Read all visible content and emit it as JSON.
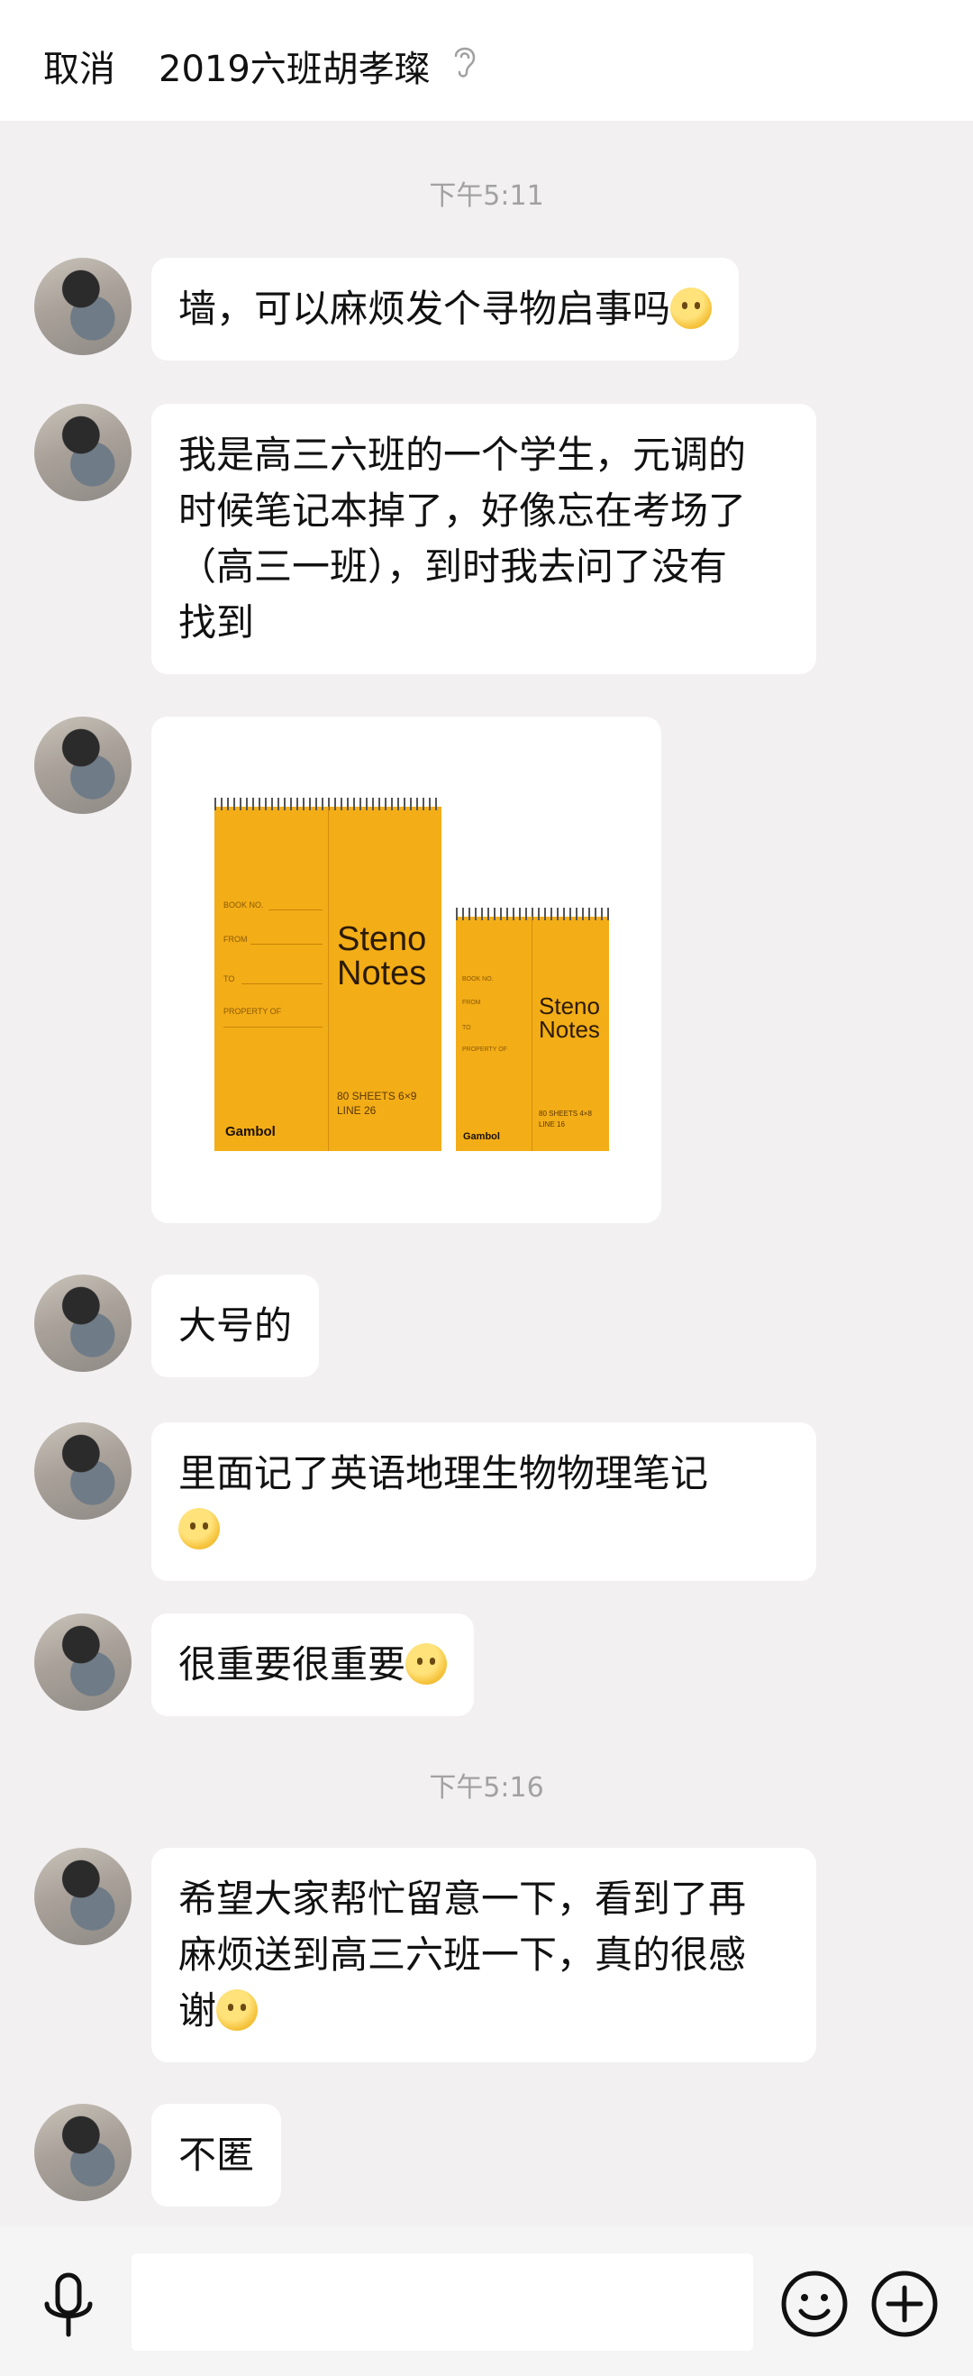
{
  "header": {
    "cancel_label": "取消",
    "title": "2019六班胡孝璨",
    "mode_icon": "ear-icon"
  },
  "timestamps": [
    "下午5:11",
    "下午5:16"
  ],
  "messages": [
    {
      "lines": [
        "墙，可以麻烦发个寻物启事吗"
      ],
      "emoji": "smile-emoji"
    },
    {
      "lines": [
        "我是高三六班的一个学生，元调的",
        "时候笔记本掉了，好像忘在考场了",
        "（高三一班），到时我去问了没有",
        "找到"
      ]
    },
    {
      "image": "steno-notebooks-photo"
    },
    {
      "lines": [
        "大号的"
      ]
    },
    {
      "lines": [
        "里面记了英语地理生物物理笔记"
      ],
      "emoji": "thinking-emoji"
    },
    {
      "lines": [
        "很重要很重要"
      ],
      "emoji": "thinking-emoji"
    },
    {
      "lines": [
        "希望大家帮忙留意一下，看到了再",
        "麻烦送到高三六班一下，真的很感",
        "谢"
      ],
      "emoji": "shy-emoji"
    },
    {
      "lines": [
        "不匿"
      ]
    }
  ],
  "notebook_large": {
    "fields": [
      "BOOK NO.",
      "FROM",
      "TO",
      "PROPERTY OF"
    ],
    "title_line1": "Steno",
    "title_line2": "Notes",
    "sheets": "80 SHEETS  6×9",
    "line": "LINE 26",
    "brand": "Gambol"
  },
  "notebook_small": {
    "fields": [
      "BOOK NO.",
      "FROM",
      "TO",
      "PROPERTY OF"
    ],
    "title_line1": "Steno",
    "title_line2": "Notes",
    "sheets": "80 SHEETS  4×8",
    "line": "LINE 16",
    "brand": "Gambol"
  },
  "bottom_bar": {
    "input_placeholder": "",
    "icons": [
      "microphone-icon",
      "emoji-icon",
      "plus-icon"
    ]
  },
  "colors": {
    "background": "#f2f0f1",
    "bubble": "#ffffff",
    "timestamp": "#a2a2a2",
    "notebook": "#f3ad17"
  }
}
